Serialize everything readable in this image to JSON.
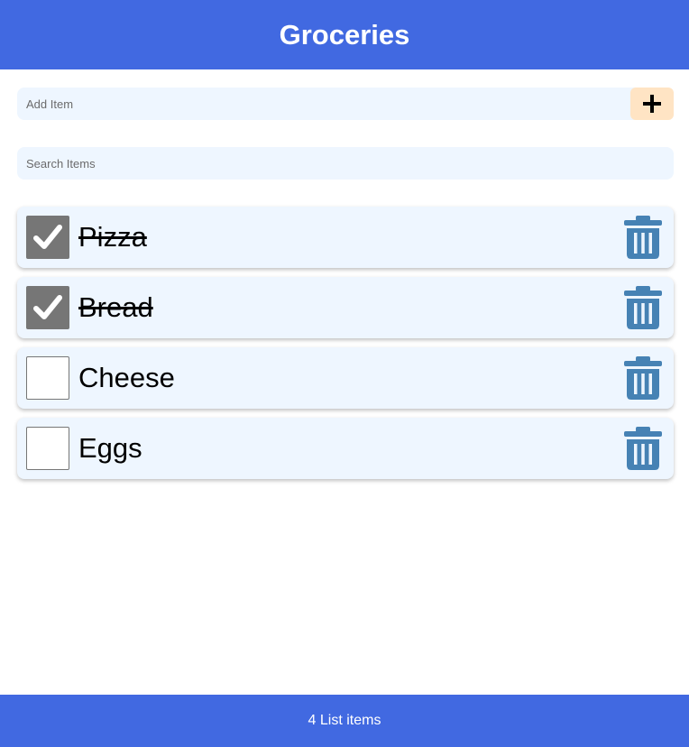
{
  "header": {
    "title": "Groceries"
  },
  "add_form": {
    "placeholder": "Add Item",
    "button_icon": "plus-icon"
  },
  "search": {
    "placeholder": "Search Items"
  },
  "items": [
    {
      "label": "Pizza",
      "checked": true
    },
    {
      "label": "Bread",
      "checked": true
    },
    {
      "label": "Cheese",
      "checked": false
    },
    {
      "label": "Eggs",
      "checked": false
    }
  ],
  "footer": {
    "text": "4 List items"
  },
  "colors": {
    "header_bg": "#4169e1",
    "field_bg": "#eef6ff",
    "add_button_bg": "#ffe4c4",
    "trash_icon": "#4682b4",
    "checkbox_checked": "#767676"
  }
}
